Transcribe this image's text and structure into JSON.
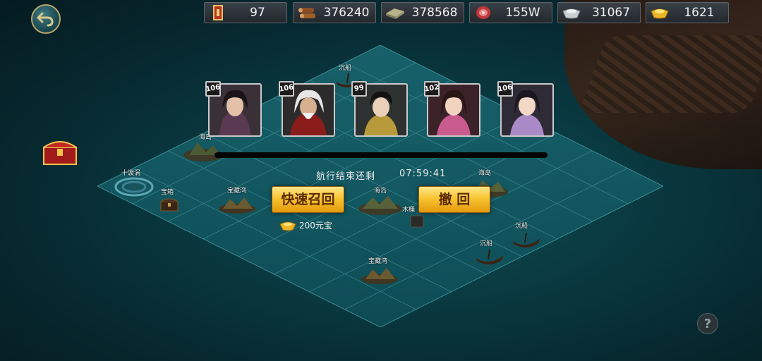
{
  "resources": [
    {
      "icon": "token-scroll-icon",
      "value": "97"
    },
    {
      "icon": "wood-logs-icon",
      "value": "376240"
    },
    {
      "icon": "stone-icon",
      "value": "378568"
    },
    {
      "icon": "meat-icon",
      "value": "155W"
    },
    {
      "icon": "silver-ingot-icon",
      "value": "31067"
    },
    {
      "icon": "gold-ingot-icon",
      "value": "1621"
    }
  ],
  "heroes": [
    {
      "level": "106"
    },
    {
      "level": "106"
    },
    {
      "level": "99"
    },
    {
      "level": "102"
    },
    {
      "level": "106"
    }
  ],
  "voyage": {
    "label": "航行结束还剩",
    "time": "07:59:41"
  },
  "buttons": {
    "recall_fast": "快速召回",
    "withdraw": "撤 回"
  },
  "cost": {
    "text": "200元宝"
  },
  "map_labels": {
    "shipwreck_top": "沉船",
    "island_left": "海岛",
    "whirlpool": "十漩涡",
    "chest_left": "宝箱",
    "treasure_left": "宝藏湾",
    "island_center": "海岛",
    "island_mid_top": "海岛",
    "island_right": "海岛",
    "mid_small": "木桶",
    "shipwreck_right1": "沉船",
    "shipwreck_right2": "沉船",
    "treasure_bottom": "宝藏湾"
  },
  "help": "?"
}
